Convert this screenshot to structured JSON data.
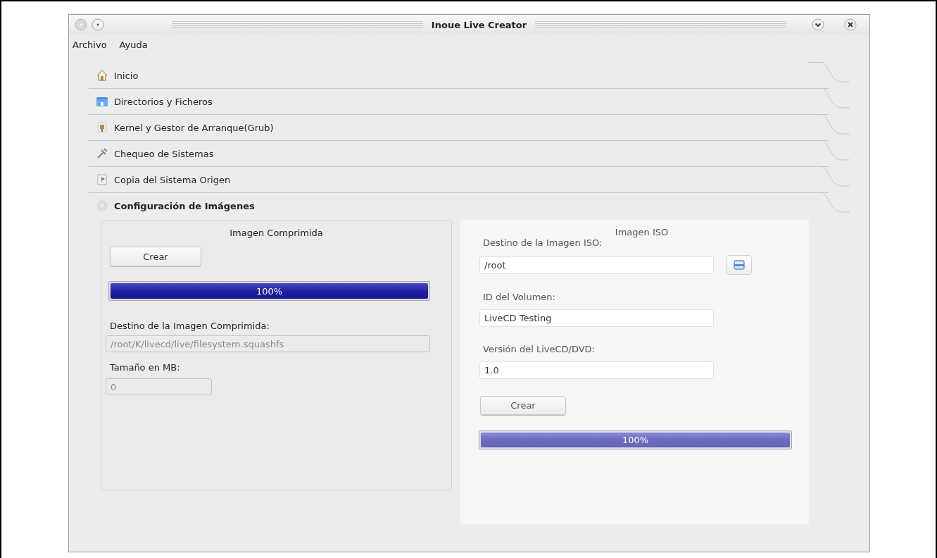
{
  "window": {
    "title": "Inoue Live Creator"
  },
  "menu": [
    {
      "label": "Archivo"
    },
    {
      "label": "Ayuda"
    }
  ],
  "sections": [
    {
      "label": "Inicio",
      "expanded": false
    },
    {
      "label": "Directorios y Ficheros",
      "expanded": false
    },
    {
      "label": "Kernel y Gestor de Arranque(Grub)",
      "expanded": false
    },
    {
      "label": "Chequeo de Sistemas",
      "expanded": false
    },
    {
      "label": "Copia del Sistema Origen",
      "expanded": false
    },
    {
      "label": "Configuración de Imágenes",
      "expanded": true
    }
  ],
  "compressed": {
    "title": "Imagen Comprimida",
    "button": "Crear",
    "progress": {
      "level": 1,
      "text": "100%",
      "active": true
    },
    "fields": [
      {
        "label": "Destino de la Imagen Comprimida:",
        "value": "/root/K/livecd/live/filesystem.squashfs",
        "disabled": true
      },
      {
        "label": "Tamaño en MB:",
        "value": "0",
        "disabled": true
      }
    ]
  },
  "iso": {
    "title": "Imagen ISO",
    "fields": [
      {
        "label": "Destino de la Imagen ISO:",
        "value": "/root",
        "disabled": false
      },
      {
        "label": "ID del Volumen:",
        "value": "LiveCD Testing",
        "disabled": false
      },
      {
        "label": "Versión del LiveCD/DVD:",
        "value": "1.0",
        "disabled": false
      }
    ],
    "button": "Crear",
    "progress": {
      "level": 1,
      "text": "100%",
      "active": false
    }
  }
}
